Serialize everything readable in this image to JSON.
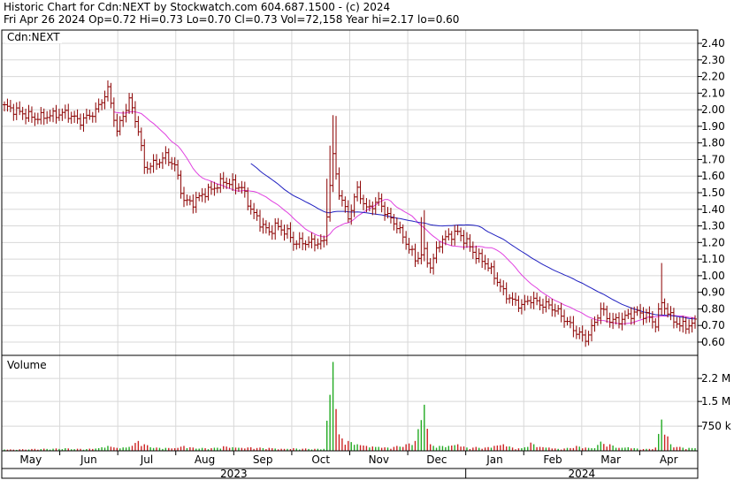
{
  "header": {
    "line1": "Historic Chart for Cdn:NEXT by Stockwatch.com 604.687.1500 - (c) 2024",
    "line2": "Fri Apr 26 2024   Op=0.72  Hi=0.73  Lo=0.70  Cl=0.73  Vol=72,158  Year hi=2.17  lo=0.60"
  },
  "panel": {
    "symbol": "Cdn:NEXT",
    "volume_label": "Volume"
  },
  "chart_data": {
    "type": "ohlc",
    "title": "Historic Chart for Cdn:NEXT",
    "price_axis": {
      "ticks": [
        0.6,
        0.7,
        0.8,
        0.9,
        1.0,
        1.1,
        1.2,
        1.3,
        1.4,
        1.5,
        1.6,
        1.7,
        1.8,
        1.9,
        2.0,
        2.1,
        2.2,
        2.3,
        2.4
      ],
      "tick_labels": [
        "0.60",
        "0.70",
        "0.80",
        "0.90",
        "1.00",
        "1.10",
        "1.20",
        "1.30",
        "1.40",
        "1.50",
        "1.60",
        "1.70",
        "1.80",
        "1.90",
        "2.00",
        "2.10",
        "2.20",
        "2.30",
        "2.40"
      ],
      "range": [
        0.52,
        2.48
      ],
      "position": "right"
    },
    "volume_axis": {
      "ticks": [
        750000,
        1500000,
        2200000
      ],
      "tick_labels": [
        "750 k",
        "1.5 M",
        "2.2 M"
      ],
      "range": [
        0,
        2900000
      ],
      "position": "right"
    },
    "months": [
      "May",
      "Jun",
      "Jul",
      "Aug",
      "Sep",
      "Oct",
      "Nov",
      "Dec",
      "Jan",
      "Feb",
      "Mar",
      "Apr"
    ],
    "years": [
      "2023",
      "2024"
    ],
    "grid": true,
    "anchors": [
      [
        0,
        2.02,
        40000
      ],
      [
        10,
        1.95,
        60000
      ],
      [
        20,
        1.98,
        80000
      ],
      [
        25,
        1.93,
        60000
      ],
      [
        30,
        1.99,
        70000
      ],
      [
        34,
        2.12,
        150000
      ],
      [
        37,
        1.87,
        90000
      ],
      [
        41,
        2.06,
        120000
      ],
      [
        44,
        1.88,
        300000
      ],
      [
        46,
        1.65,
        200000
      ],
      [
        50,
        1.68,
        100000
      ],
      [
        53,
        1.72,
        90000
      ],
      [
        56,
        1.66,
        80000
      ],
      [
        59,
        1.45,
        150000
      ],
      [
        62,
        1.44,
        100000
      ],
      [
        65,
        1.49,
        90000
      ],
      [
        68,
        1.52,
        80000
      ],
      [
        72,
        1.57,
        140000
      ],
      [
        75,
        1.55,
        110000
      ],
      [
        78,
        1.53,
        90000
      ],
      [
        81,
        1.4,
        110000
      ],
      [
        84,
        1.32,
        100000
      ],
      [
        87,
        1.26,
        90000
      ],
      [
        89,
        1.3,
        70000
      ],
      [
        93,
        1.26,
        60000
      ],
      [
        95,
        1.2,
        80000
      ],
      [
        105,
        1.2,
        60000
      ],
      [
        108,
        1.72,
        2700000
      ],
      [
        110,
        1.5,
        500000
      ],
      [
        113,
        1.35,
        300000
      ],
      [
        116,
        1.52,
        200000
      ],
      [
        119,
        1.4,
        150000
      ],
      [
        123,
        1.45,
        120000
      ],
      [
        126,
        1.36,
        100000
      ],
      [
        129,
        1.3,
        150000
      ],
      [
        132,
        1.2,
        200000
      ],
      [
        135,
        1.1,
        300000
      ],
      [
        138,
        1.14,
        1400000
      ],
      [
        140,
        1.05,
        200000
      ],
      [
        143,
        1.2,
        150000
      ],
      [
        146,
        1.24,
        150000
      ],
      [
        149,
        1.26,
        200000
      ],
      [
        152,
        1.2,
        100000
      ],
      [
        155,
        1.12,
        120000
      ],
      [
        158,
        1.08,
        100000
      ],
      [
        161,
        1.0,
        150000
      ],
      [
        164,
        0.9,
        200000
      ],
      [
        167,
        0.85,
        100000
      ],
      [
        170,
        0.82,
        80000
      ],
      [
        173,
        0.86,
        250000
      ],
      [
        176,
        0.83,
        120000
      ],
      [
        179,
        0.82,
        100000
      ],
      [
        182,
        0.78,
        60000
      ],
      [
        185,
        0.72,
        90000
      ],
      [
        188,
        0.66,
        150000
      ],
      [
        191,
        0.62,
        100000
      ],
      [
        193,
        0.68,
        80000
      ],
      [
        196,
        0.8,
        280000
      ],
      [
        199,
        0.73,
        200000
      ],
      [
        202,
        0.73,
        90000
      ],
      [
        205,
        0.76,
        110000
      ],
      [
        208,
        0.78,
        70000
      ],
      [
        211,
        0.76,
        60000
      ],
      [
        214,
        0.71,
        100000
      ],
      [
        216,
        0.84,
        950000
      ],
      [
        219,
        0.75,
        200000
      ],
      [
        222,
        0.7,
        120000
      ],
      [
        225,
        0.7,
        90000
      ],
      [
        227,
        0.72,
        80000
      ]
    ],
    "bar_count": 228,
    "indicators": [
      {
        "kind": "moving_average",
        "color": "#e040e0"
      },
      {
        "kind": "moving_average",
        "color": "#2020c0"
      }
    ],
    "colors": {
      "bar": "#8b0000",
      "grid": "#d8d8d8",
      "axis": "#000000",
      "volume_up": "#22aa22",
      "volume_down": "#cc2222"
    }
  }
}
